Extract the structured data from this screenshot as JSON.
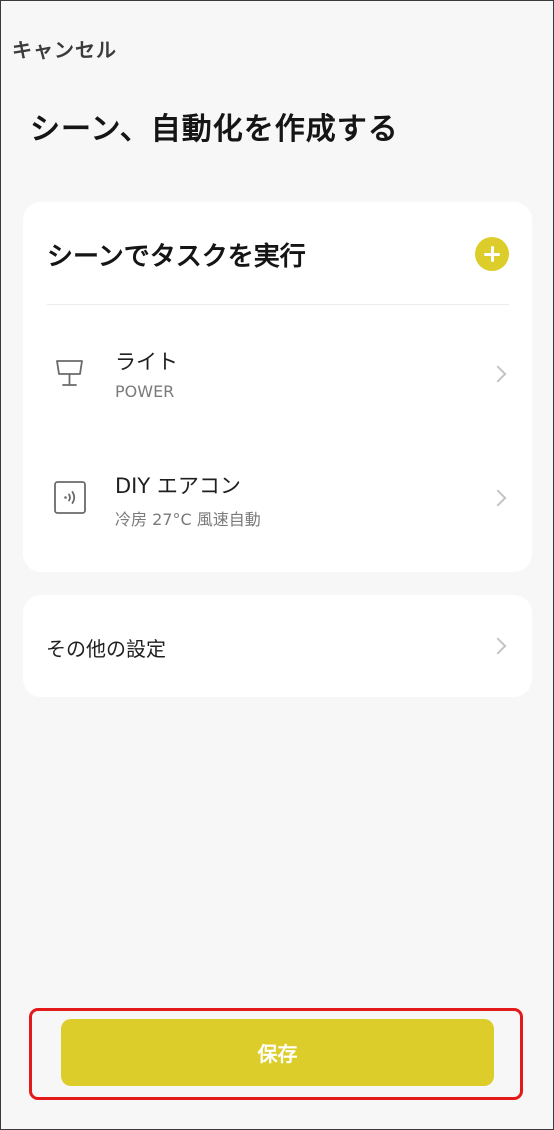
{
  "header": {
    "cancel_label": "キャンセル",
    "title": "シーン、自動化を作成する"
  },
  "tasks_card": {
    "title": "シーンでタスクを実行",
    "add_icon": "plus-circle-icon",
    "items": [
      {
        "name": "ライト",
        "detail": "POWER",
        "icon": "lamp-icon"
      },
      {
        "name": "DIY エアコン",
        "detail": "冷房 27°C 風速自動",
        "icon": "remote-signal-icon"
      }
    ]
  },
  "other_settings": {
    "label": "その他の設定"
  },
  "footer": {
    "save_label": "保存"
  },
  "colors": {
    "accent": "#dccd2b",
    "background": "#f7f7f7",
    "card": "#ffffff",
    "highlight": "#e41a1a"
  }
}
